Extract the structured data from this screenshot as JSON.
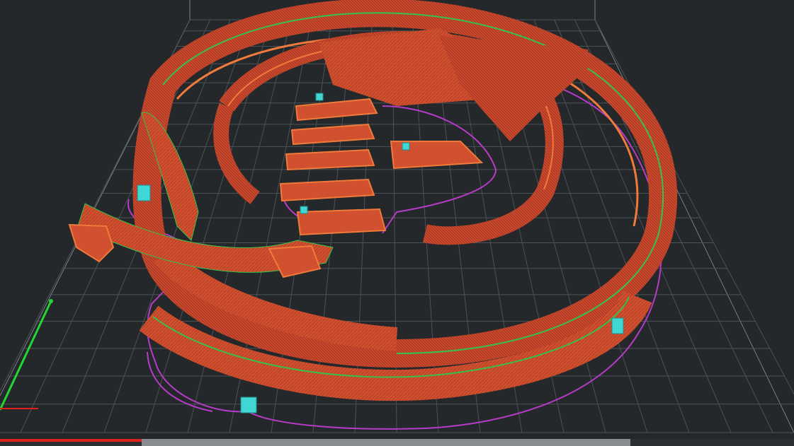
{
  "app": {
    "view": "gcode-preview-3d",
    "icons": [
      "bed-grid-icon",
      "axis-y-icon",
      "axis-x-icon"
    ]
  },
  "colors": {
    "background": "#24282b",
    "grid": "#4c5257",
    "bed_outline": "#7a7f84",
    "perimeter": "#c6432b",
    "perimeter_highlight": "#f07a3a",
    "infill_edge": "#36c24a",
    "skirt": "#b63bc7",
    "support": "#3fd6d3",
    "axis_y": "#22d633",
    "axis_x": "#e0201a",
    "progress": "#e0201a",
    "scrollbar": "#8a8d90"
  },
  "progress": {
    "fraction": 0.18
  },
  "watermark": {
    "text": ""
  }
}
